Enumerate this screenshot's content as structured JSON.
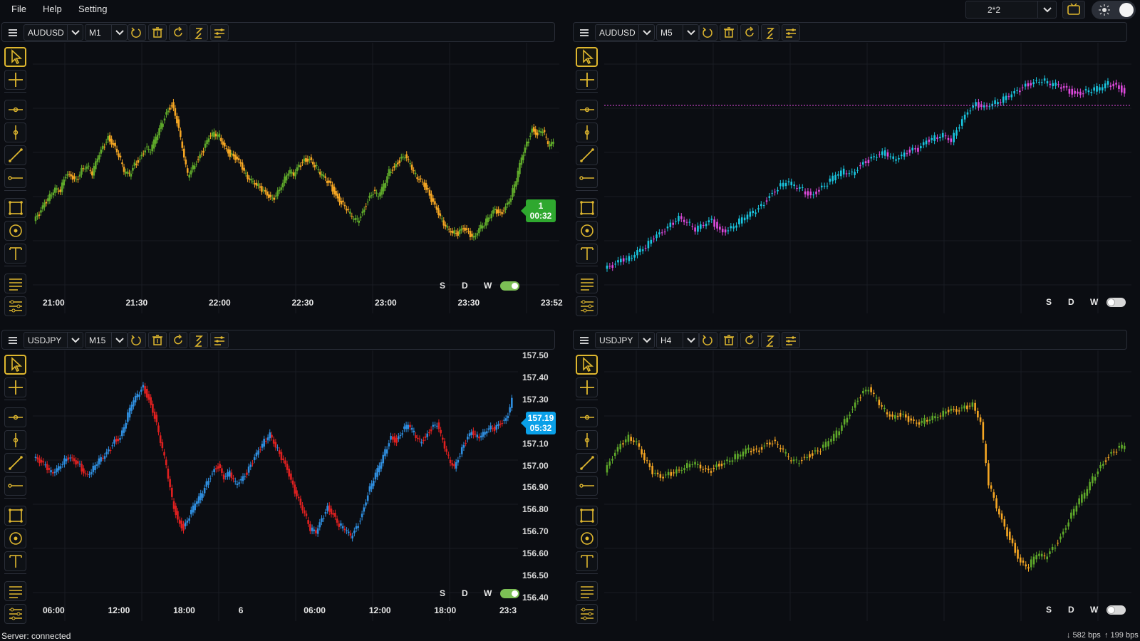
{
  "menu": {
    "file": "File",
    "help": "Help",
    "setting": "Setting"
  },
  "layout": {
    "value": "2*2"
  },
  "colors": {
    "accent": "#e0b82f",
    "up_yellow": "#f5a623",
    "green": "#5faa2a",
    "red": "#e02020",
    "blue": "#2f8fe0",
    "cyan": "#19c6e0",
    "magenta": "#e04adf"
  },
  "panels": [
    {
      "symbol": "AUDUSD",
      "timeframe": "M1",
      "time_labels": [
        "21:00",
        "21:30",
        "22:00",
        "22:30",
        "23:00",
        "23:30",
        "23:52"
      ],
      "price_labels": [],
      "current_tag": {
        "line1": "1",
        "line2": "00:32",
        "color": "#2fa82f"
      },
      "switches": {
        "s": "S",
        "d": "D",
        "w": "W",
        "state": "on"
      }
    },
    {
      "symbol": "AUDUSD",
      "timeframe": "M5",
      "time_labels": [],
      "price_labels": [],
      "switches": {
        "s": "S",
        "d": "D",
        "w": "W",
        "state": "off"
      }
    },
    {
      "symbol": "USDJPY",
      "timeframe": "M15",
      "time_labels": [
        "06:00",
        "12:00",
        "18:00",
        "6",
        "06:00",
        "12:00",
        "18:00",
        "23:3"
      ],
      "price_labels": [
        "157.50",
        "157.40",
        "157.30",
        "157.10",
        "157.00",
        "156.90",
        "156.80",
        "156.70",
        "156.60",
        "156.50",
        "156.40"
      ],
      "current_tag": {
        "line1": "157.19",
        "line2": "05:32",
        "color": "#0aa0e8"
      },
      "switches": {
        "s": "S",
        "d": "D",
        "w": "W",
        "state": "on"
      }
    },
    {
      "symbol": "USDJPY",
      "timeframe": "H4",
      "time_labels": [],
      "price_labels": [],
      "switches": {
        "s": "S",
        "d": "D",
        "w": "W",
        "state": "off"
      }
    }
  ],
  "status": {
    "server_label": "Server:",
    "server_state": "connected",
    "down": "↓ 582 bps",
    "up": "↑ 199 bps"
  },
  "tools": [
    "cursor-icon",
    "crosshair-icon",
    "horizontal-ray-icon",
    "vertical-line-icon",
    "trend-line-icon",
    "horizontal-line-icon",
    "rectangle-icon",
    "circle-icon",
    "text-icon",
    "fib-icon",
    "settings-lines-icon"
  ],
  "series": {
    "p0": [
      0.28,
      0.31,
      0.36,
      0.4,
      0.44,
      0.43,
      0.5,
      0.49,
      0.47,
      0.53,
      0.55,
      0.51,
      0.58,
      0.63,
      0.68,
      0.65,
      0.6,
      0.52,
      0.5,
      0.55,
      0.58,
      0.63,
      0.62,
      0.68,
      0.74,
      0.8,
      0.84,
      0.76,
      0.63,
      0.5,
      0.54,
      0.58,
      0.62,
      0.68,
      0.7,
      0.69,
      0.64,
      0.6,
      0.58,
      0.55,
      0.5,
      0.48,
      0.46,
      0.43,
      0.4,
      0.38,
      0.42,
      0.47,
      0.52,
      0.5,
      0.54,
      0.57,
      0.58,
      0.55,
      0.51,
      0.48,
      0.45,
      0.4,
      0.37,
      0.34,
      0.3,
      0.28,
      0.32,
      0.38,
      0.42,
      0.4,
      0.45,
      0.52,
      0.54,
      0.57,
      0.59,
      0.55,
      0.5,
      0.48,
      0.44,
      0.38,
      0.33,
      0.28,
      0.25,
      0.23,
      0.22,
      0.24,
      0.22,
      0.2,
      0.25,
      0.27,
      0.3,
      0.33,
      0.31,
      0.35,
      0.4,
      0.48,
      0.58,
      0.65,
      0.72,
      0.7,
      0.72,
      0.65,
      0.65
    ],
    "p1": [
      0.05,
      0.06,
      0.09,
      0.1,
      0.14,
      0.16,
      0.2,
      0.22,
      0.26,
      0.3,
      0.28,
      0.24,
      0.26,
      0.28,
      0.23,
      0.24,
      0.27,
      0.3,
      0.32,
      0.35,
      0.4,
      0.44,
      0.47,
      0.45,
      0.43,
      0.4,
      0.43,
      0.46,
      0.5,
      0.52,
      0.51,
      0.55,
      0.57,
      0.59,
      0.61,
      0.58,
      0.6,
      0.62,
      0.62,
      0.66,
      0.68,
      0.7,
      0.67,
      0.74,
      0.8,
      0.84,
      0.83,
      0.85,
      0.86,
      0.88,
      0.9,
      0.93,
      0.95,
      0.96,
      0.94,
      0.93,
      0.91,
      0.89,
      0.9,
      0.91,
      0.92,
      0.94,
      0.93,
      0.9
    ],
    "p2": [
      0.62,
      0.6,
      0.58,
      0.55,
      0.57,
      0.6,
      0.62,
      0.6,
      0.58,
      0.54,
      0.56,
      0.6,
      0.62,
      0.65,
      0.7,
      0.72,
      0.8,
      0.88,
      0.92,
      0.96,
      0.9,
      0.82,
      0.7,
      0.58,
      0.42,
      0.32,
      0.28,
      0.34,
      0.4,
      0.44,
      0.5,
      0.55,
      0.58,
      0.52,
      0.55,
      0.5,
      0.52,
      0.55,
      0.6,
      0.65,
      0.7,
      0.74,
      0.68,
      0.62,
      0.56,
      0.48,
      0.42,
      0.36,
      0.28,
      0.26,
      0.32,
      0.38,
      0.35,
      0.3,
      0.28,
      0.24,
      0.28,
      0.35,
      0.45,
      0.52,
      0.58,
      0.65,
      0.72,
      0.7,
      0.75,
      0.78,
      0.74,
      0.7,
      0.72,
      0.76,
      0.78,
      0.7,
      0.62,
      0.58,
      0.64,
      0.7,
      0.74,
      0.72,
      0.74,
      0.77,
      0.76,
      0.78,
      0.8,
      0.9
    ],
    "p3": [
      0.55,
      0.62,
      0.68,
      0.72,
      0.7,
      0.62,
      0.55,
      0.52,
      0.54,
      0.56,
      0.58,
      0.6,
      0.57,
      0.55,
      0.58,
      0.6,
      0.62,
      0.64,
      0.66,
      0.65,
      0.68,
      0.7,
      0.67,
      0.62,
      0.6,
      0.62,
      0.64,
      0.66,
      0.7,
      0.74,
      0.8,
      0.86,
      0.92,
      0.95,
      0.9,
      0.85,
      0.82,
      0.83,
      0.8,
      0.78,
      0.8,
      0.82,
      0.83,
      0.85,
      0.84,
      0.86,
      0.88,
      0.8,
      0.5,
      0.38,
      0.28,
      0.2,
      0.12,
      0.1,
      0.16,
      0.14,
      0.18,
      0.24,
      0.32,
      0.4,
      0.45,
      0.52,
      0.58,
      0.63,
      0.66,
      0.68
    ]
  }
}
